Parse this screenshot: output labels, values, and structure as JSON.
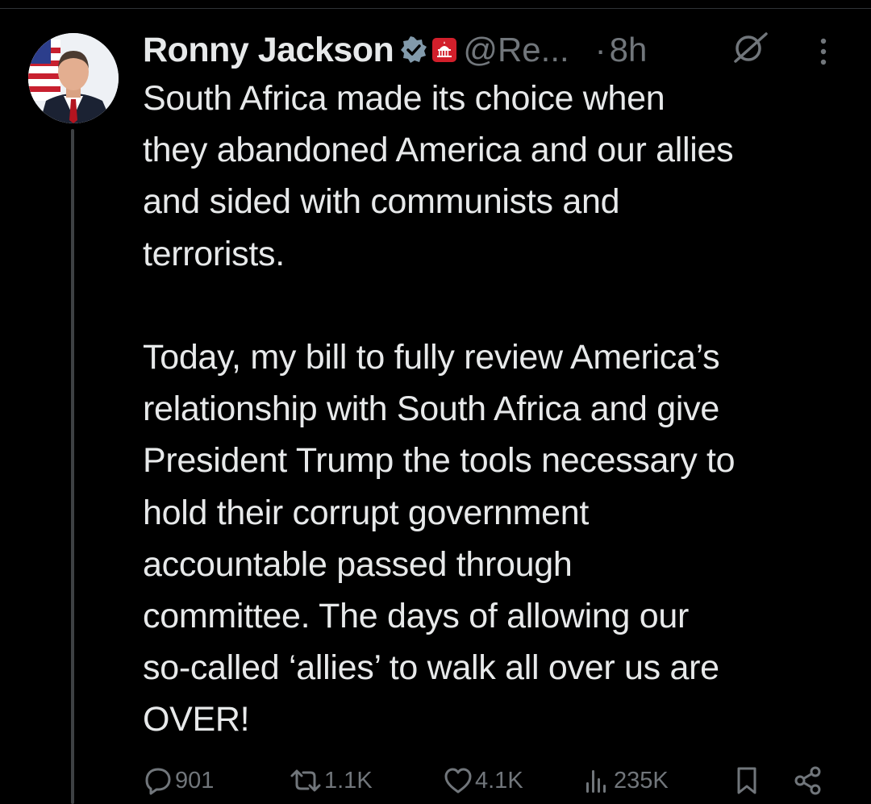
{
  "post": {
    "author": {
      "display_name": "Ronny Jackson",
      "handle": "@Re...",
      "verified_icon": "verified-badge-icon",
      "affiliation_icon": "capitol-badge-icon"
    },
    "timestamp_separator": "·",
    "timestamp": "8h",
    "text_lines": [
      "South Africa made its choice when",
      "they abandoned America and our allies",
      "and sided with communists and",
      "terrorists.",
      "",
      "Today, my bill to fully review America’s",
      "relationship with South Africa and give",
      "President Trump the tools necessary to",
      "hold their corrupt government",
      "accountable passed through",
      "committee. The days of allowing our",
      "so-called ‘allies’ to walk all over us are",
      "OVER!"
    ],
    "actions": {
      "replies": "901",
      "reposts": "1.1K",
      "likes": "4.1K",
      "views": "235K"
    }
  },
  "colors": {
    "background": "#000000",
    "text_primary": "#e7e9ea",
    "text_secondary": "#71767b",
    "verified_blue_gray": "#829aab",
    "affiliation_red": "#d21f2b"
  }
}
